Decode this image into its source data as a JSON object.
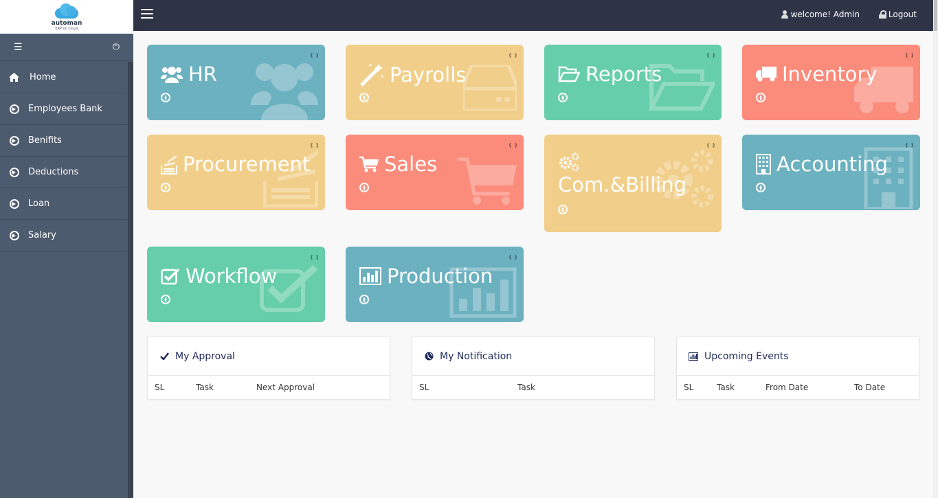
{
  "logo": {
    "name": "automan",
    "tagline": "ERP on Cloud"
  },
  "sidebar": {
    "items": [
      {
        "label": "Home",
        "icon": "home-icon"
      },
      {
        "label": "Employees Bank",
        "icon": "circle-arrow-right-icon"
      },
      {
        "label": "Benifits",
        "icon": "circle-arrow-right-icon"
      },
      {
        "label": "Deductions",
        "icon": "circle-arrow-right-icon"
      },
      {
        "label": "Loan",
        "icon": "circle-arrow-right-icon"
      },
      {
        "label": "Salary",
        "icon": "circle-arrow-right-icon"
      }
    ]
  },
  "topbar": {
    "user_label": "welcome! Admin",
    "logout_label": "Logout"
  },
  "tiles": [
    {
      "label": "HR",
      "color": "#6cb1c0",
      "icon": "users-icon"
    },
    {
      "label": "Payrolls",
      "color": "#f1cf8a",
      "icon": "magic-wand-icon"
    },
    {
      "label": "Reports",
      "color": "#66ceaa",
      "icon": "folder-open-icon"
    },
    {
      "label": "Inventory",
      "color": "#fb8b7b",
      "icon": "truck-icon"
    },
    {
      "label": "Procurement",
      "color": "#f1cf8a",
      "icon": "stack-icon"
    },
    {
      "label": "Sales",
      "color": "#fb8b7b",
      "icon": "shopping-cart-icon"
    },
    {
      "label": "Com.&Billing",
      "color": "#f1cf8a",
      "icon": "gears-icon"
    },
    {
      "label": "Accounting",
      "color": "#6cb1c0",
      "icon": "building-icon"
    },
    {
      "label": "Workflow",
      "color": "#66ceaa",
      "icon": "check-square-icon"
    },
    {
      "label": "Production",
      "color": "#6cb1c0",
      "icon": "bar-chart-icon"
    }
  ],
  "panels": {
    "approval": {
      "title": "My Approval",
      "columns": [
        "SL",
        "Task",
        "Next Approval"
      ]
    },
    "notification": {
      "title": "My Notification",
      "columns": [
        "SL",
        "Task"
      ]
    },
    "events": {
      "title": "Upcoming Events",
      "columns": [
        "SL",
        "Task",
        "From Date",
        "To Date"
      ]
    }
  }
}
